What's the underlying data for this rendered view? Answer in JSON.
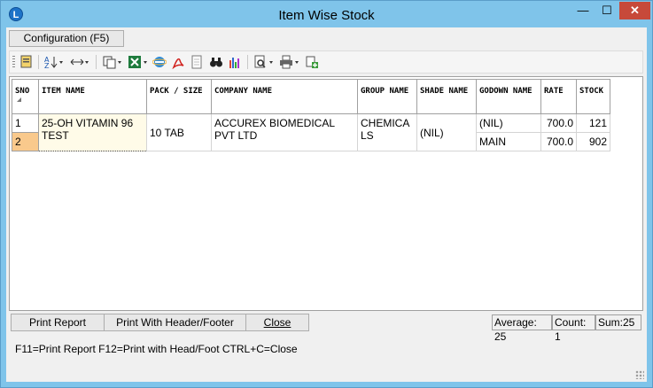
{
  "window": {
    "title": "Item Wise Stock",
    "app_icon": "L",
    "close_glyph": "✕",
    "min_glyph": "—",
    "max_glyph": "☐"
  },
  "menu": {
    "configuration_label": "Configuration (F5)"
  },
  "toolbar": {
    "icons": [
      "report-icon",
      "sort-az-icon",
      "column-width-icon",
      "copy-icon",
      "excel-icon",
      "ie-icon",
      "pdf-icon",
      "document-icon",
      "binoculars-icon",
      "chart-icon",
      "preview-icon",
      "printer-icon",
      "export-icon"
    ]
  },
  "grid": {
    "columns": [
      "SNO",
      "ITEM NAME",
      "PACK / SIZE",
      "COMPANY NAME",
      "GROUP NAME",
      "SHADE NAME",
      "GODOWN NAME",
      "RATE",
      "STOCK"
    ],
    "rows": [
      {
        "sno": "1",
        "item_name": "25-OH VITAMIN 96 TEST",
        "pack": "10 TAB",
        "company": "ACCUREX BIOMEDICAL PVT LTD",
        "group": "CHEMICALS",
        "shade": "(NIL)",
        "godown": "(NIL)",
        "rate": "700.0",
        "stock": "121"
      },
      {
        "sno": "2",
        "godown": "MAIN",
        "rate": "700.0",
        "stock": "902"
      }
    ]
  },
  "buttons": {
    "print_report": "Print Report",
    "print_header_footer": "Print With Header/Footer",
    "close": "Close"
  },
  "status": {
    "average": "Average: 25",
    "count": "Count: 1",
    "sum": "Sum:25"
  },
  "hint": "F11=Print Report  F12=Print with Head/Foot  CTRL+C=Close",
  "colors": {
    "titlebar": "#7fc4ea",
    "close_button": "#c7493a",
    "selected_row_header": "#f9c98c"
  }
}
